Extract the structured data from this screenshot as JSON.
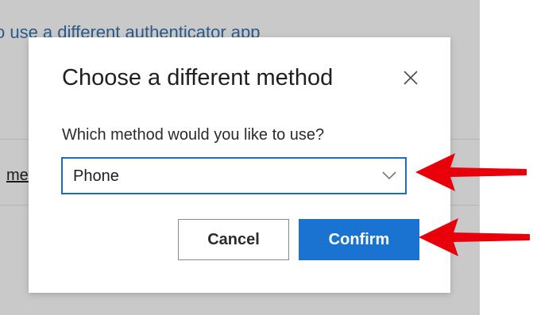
{
  "background": {
    "link_text": "o use a different authenticator app",
    "fragment_text": "me"
  },
  "dialog": {
    "title": "Choose a different method",
    "close_icon": "close-icon",
    "prompt_label": "Which method would you like to use?",
    "method_select": {
      "selected_value": "Phone",
      "icon": "chevron-down-icon"
    },
    "cancel_label": "Cancel",
    "confirm_label": "Confirm"
  },
  "annotations": {
    "arrow_color": "#e8000b",
    "arrow_targets": [
      "method-select",
      "confirm-button"
    ]
  },
  "colors": {
    "primary": "#1a73d0",
    "focus_border": "#1a6bd6",
    "overlay": "#c9c9c9"
  }
}
